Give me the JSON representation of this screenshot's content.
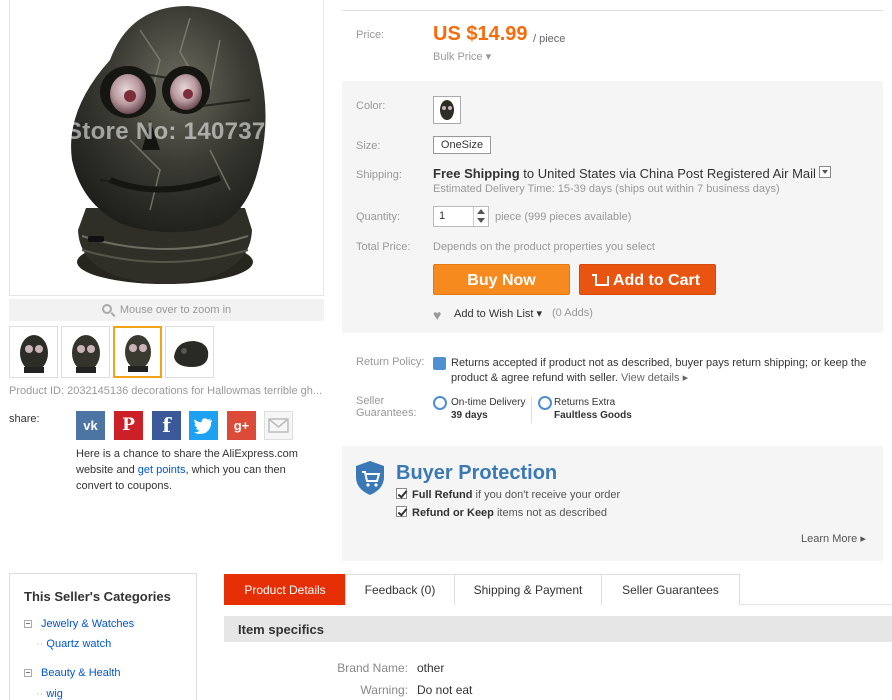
{
  "gallery": {
    "watermark": "Store No: 1407378",
    "zoom_hint": "Mouse over to zoom in",
    "product_id": "Product ID: 2032145136 decorations for Hallowmas terrible gh..."
  },
  "share": {
    "label": "share:",
    "vk": "vk",
    "pin": "P",
    "fb": "f",
    "tw": "t",
    "gp": "g+",
    "text_1": "Here is a chance to share the AliExpress.com website and ",
    "text_link": "get points",
    "text_2": ", which you can then convert to coupons."
  },
  "price": {
    "label": "Price:",
    "value": "US $14.99",
    "unit": "/ piece",
    "bulk": "Bulk Price"
  },
  "options": {
    "color_label": "Color:",
    "size_label": "Size:",
    "size_value": "OneSize",
    "shipping_label": "Shipping:",
    "shipping_free": "Free Shipping",
    "shipping_to": " to ",
    "shipping_dest": "United States via China Post Registered Air Mail",
    "delivery": "Estimated Delivery Time: 15-39 days (ships out within 7 business days)",
    "qty_label": "Quantity:",
    "qty_value": "1",
    "qty_available": "piece (999 pieces available)",
    "total_label": "Total Price:",
    "total_note": "Depends on the product properties you select"
  },
  "actions": {
    "buy_now": "Buy Now",
    "add_to_cart": "Add to Cart",
    "wish": "Add to Wish List",
    "wish_count": "(0 Adds)"
  },
  "policy": {
    "return_label": "Return Policy:",
    "return_text": "Returns accepted if product not as described, buyer pays return shipping; or keep the product & agree refund with seller.",
    "view_details": "View details",
    "guarantee_label_1": "Seller",
    "guarantee_label_2": "Guarantees:",
    "ontime_title": "On-time Delivery",
    "ontime_days": "39 days",
    "returns_title": "Returns Extra",
    "returns_value": "Faultless Goods"
  },
  "buyer_protection": {
    "title": "Buyer Protection",
    "item1_bold": "Full Refund",
    "item1_rest": " if you don't receive your order",
    "item2_bold": "Refund or Keep",
    "item2_rest": " items not as described",
    "learn_more": "Learn More"
  },
  "seller_categories": {
    "title": "This Seller's Categories",
    "cat1": "Jewelry & Watches",
    "sub1": "Quartz watch",
    "cat2": "Beauty & Health",
    "sub2": "wig"
  },
  "tabs": [
    "Product Details",
    "Feedback (0)",
    "Shipping & Payment",
    "Seller Guarantees"
  ],
  "specifics": {
    "title": "Item specifics",
    "rows": [
      {
        "k": "Brand Name:",
        "v": "other"
      },
      {
        "k": "Warning:",
        "v": "Do not eat"
      }
    ]
  },
  "colors": {
    "price": "#f66c0b",
    "buy_now": "#f68a1e",
    "add_to_cart": "#ea5411",
    "tab_active": "#e62e04",
    "protection": "#3a78b6",
    "link": "#0055cc"
  }
}
